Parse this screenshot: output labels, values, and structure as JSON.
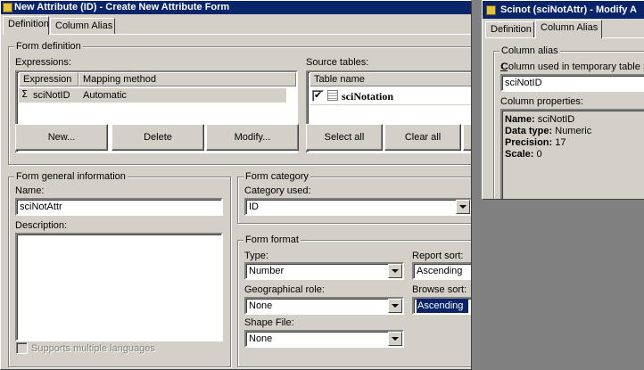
{
  "main_window": {
    "title": "New Attribute (ID) - Create New Attribute Form",
    "tabs": [
      "Definition",
      "Column Alias"
    ],
    "form_definition": {
      "group_label": "Form definition",
      "expressions_label": "Expressions:",
      "columns": [
        "Expression",
        "Mapping method"
      ],
      "rows": [
        {
          "expression": "sciNotID",
          "mapping": "Automatic"
        }
      ],
      "source_tables_label": "Source tables:",
      "source_column": "Table name",
      "source_rows": [
        {
          "name": "sciNotation",
          "checked": true
        }
      ],
      "buttons": {
        "new": "New...",
        "delete": "Delete",
        "modify": "Modify...",
        "select_all": "Select all",
        "clear_all": "Clear all"
      }
    },
    "general_info": {
      "group_label": "Form general information",
      "name_label": "Name:",
      "name_value": "sciNotAttr",
      "description_label": "Description:",
      "supports_ml_label": "Supports multiple languages"
    },
    "form_category": {
      "group_label": "Form category",
      "category_label": "Category used:",
      "category_value": "ID"
    },
    "form_format": {
      "group_label": "Form format",
      "type_label": "Type:",
      "type_value": "Number",
      "geo_label": "Geographical role:",
      "geo_value": "None",
      "shape_label": "Shape File:",
      "shape_value": "None",
      "report_sort_label": "Report sort:",
      "report_sort_value": "Ascending",
      "browse_sort_label": "Browse sort:",
      "browse_sort_value": "Ascending"
    }
  },
  "second_window": {
    "title": "Scinot (sciNotAttr) - Modify A",
    "tabs": [
      "Definition",
      "Column Alias"
    ],
    "column_alias_group": "Column alias",
    "column_used_label": "Column used in temporary table SC",
    "column_used_value": "sciNotID",
    "column_properties_label": "Column properties:",
    "properties": {
      "name_key": "Name:",
      "name_val": "sciNotID",
      "datatype_key": "Data type:",
      "datatype_val": "Numeric",
      "precision_key": "Precision:",
      "precision_val": "17",
      "scale_key": "Scale:",
      "scale_val": "0"
    }
  },
  "colors": {
    "titlebar": "#0a246a",
    "face": "#d4d0c8",
    "desktop": "#808080"
  }
}
